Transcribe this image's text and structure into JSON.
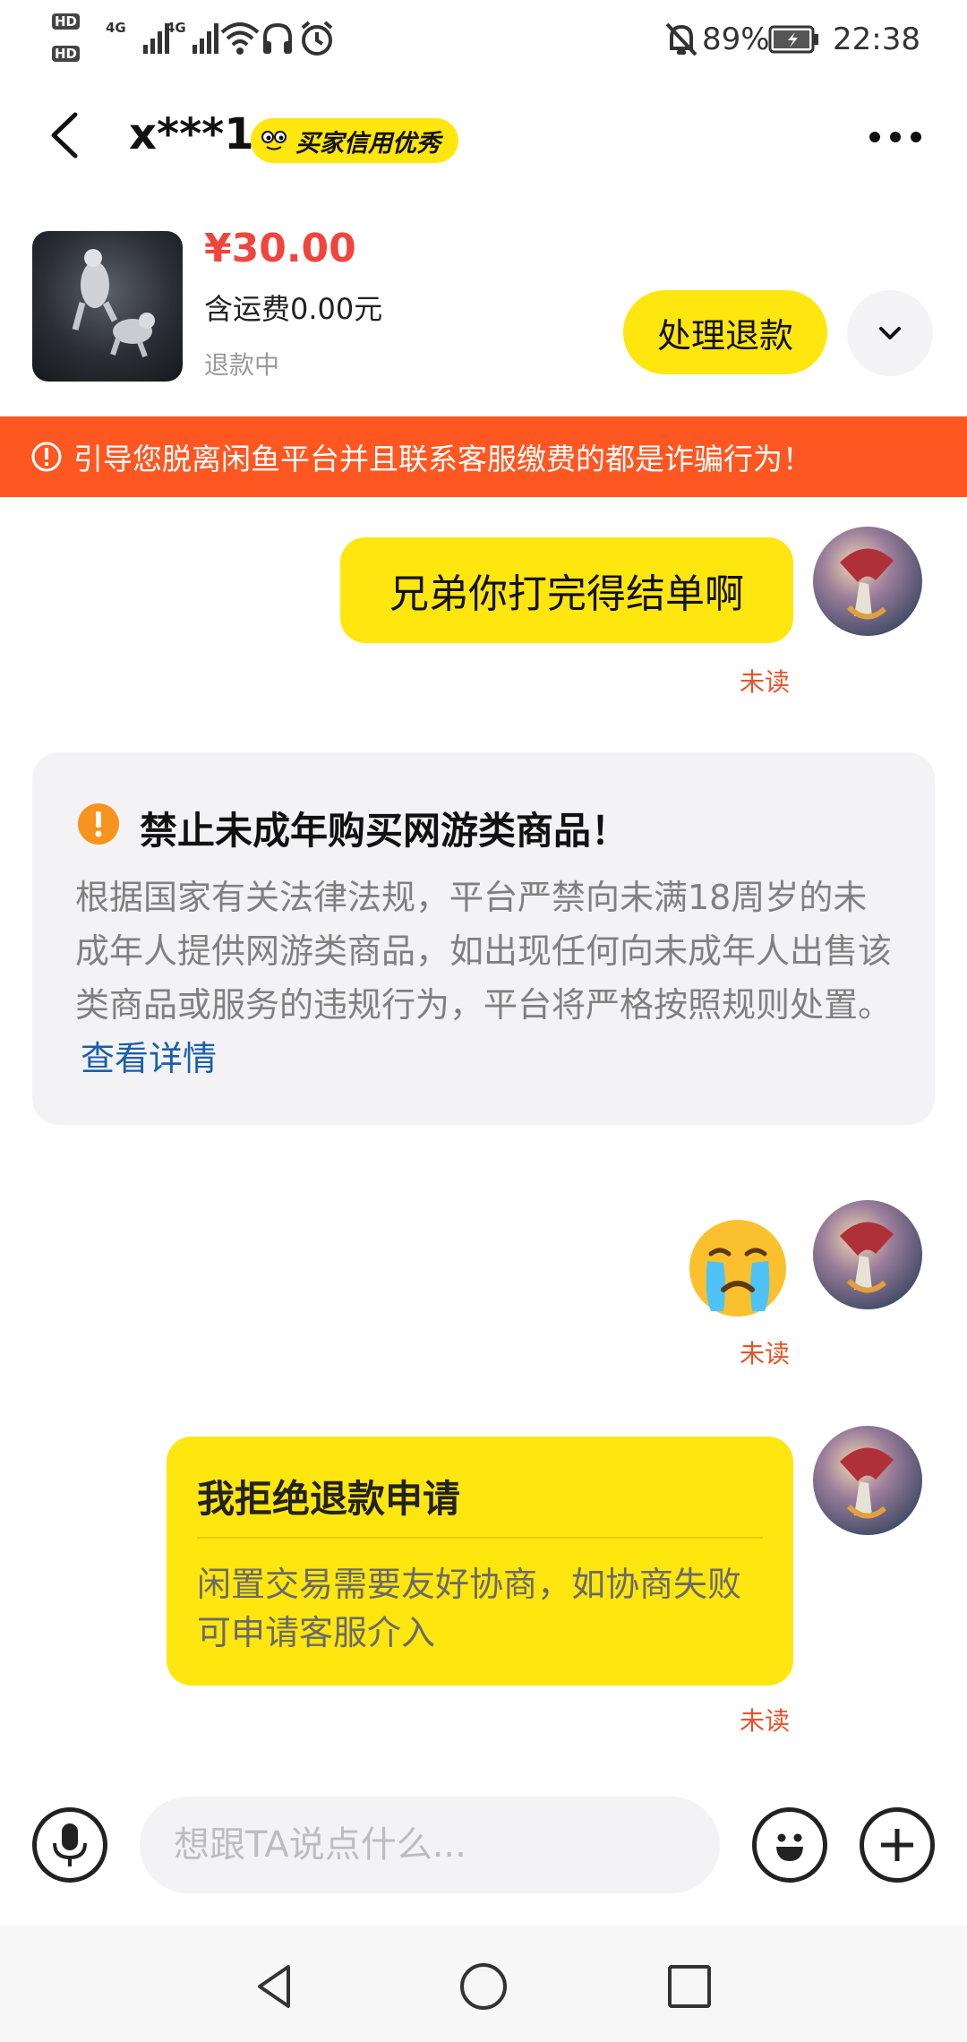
{
  "status_bar": {
    "hd1": "HD",
    "hd2": "HD",
    "net1": "4G",
    "net2": "4G",
    "battery": "89%",
    "time": "22:38"
  },
  "header": {
    "username": "x***1",
    "badge": "买家信用优秀"
  },
  "product": {
    "price": "¥30.00",
    "shipping": "含运费0.00元",
    "status": "退款中",
    "refund_button": "处理退款"
  },
  "fraud_banner": {
    "text": "引导您脱离闲鱼平台并且联系客服缴费的都是诈骗行为！"
  },
  "messages": {
    "msg1": {
      "text": "兄弟你打完得结单啊",
      "status": "未读"
    },
    "notice": {
      "title": "禁止未成年购买网游类商品！",
      "body": "根据国家有关法律法规，平台严禁向未满18周岁的未成年人提供网游类商品，如出现任何向未成年人出售该类商品或服务的违规行为，平台将严格按照规则处置。",
      "link": "查看详情"
    },
    "msg2": {
      "emoji": "😭",
      "status": "未读"
    },
    "msg3": {
      "title": "我拒绝退款申请",
      "body": "闲置交易需要友好协商，如协商失败可申请客服介入",
      "status": "未读"
    }
  },
  "input_bar": {
    "placeholder": "想跟TA说点什么..."
  },
  "colors": {
    "brand_yellow": "#FFE60F",
    "price_red": "#F0453C",
    "banner_orange": "#FF5722",
    "unread_red": "#E8522A",
    "link_blue": "#1D5FA8"
  }
}
